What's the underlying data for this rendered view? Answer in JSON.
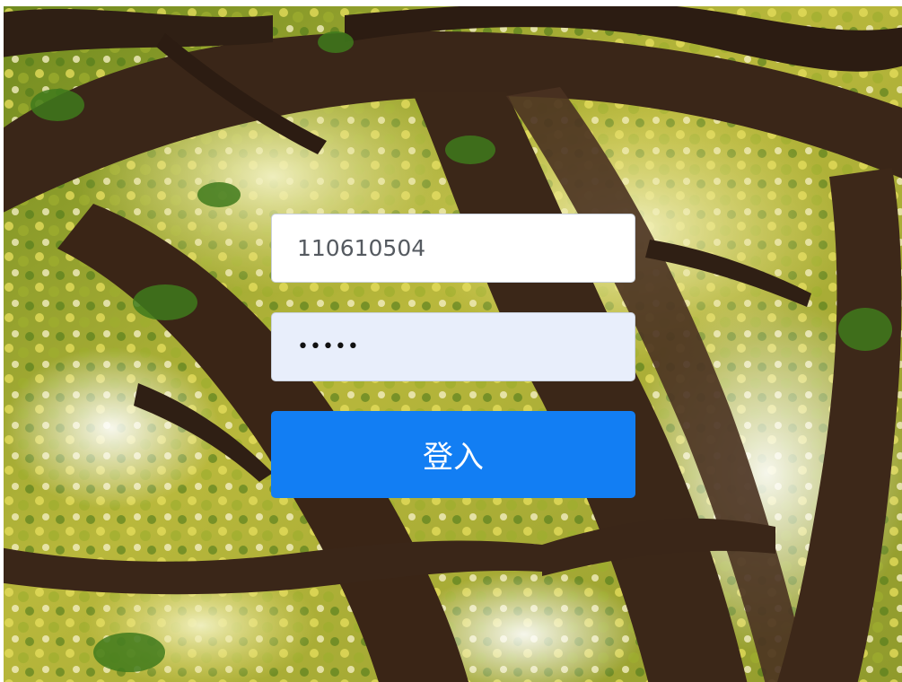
{
  "login": {
    "username_value": "110610504",
    "password_value": "12345",
    "submit_label": "登入"
  },
  "background": {
    "subject": "tree-canopy-photo",
    "colors": {
      "foliage_light": "#d9cf4a",
      "foliage_dark": "#5e7d1c",
      "trunk": "#3a2618",
      "sky": "#f4f6e8"
    }
  },
  "colors": {
    "button": "#127ef3",
    "password_field": "#e8eefb",
    "username_field": "#ffffff"
  }
}
